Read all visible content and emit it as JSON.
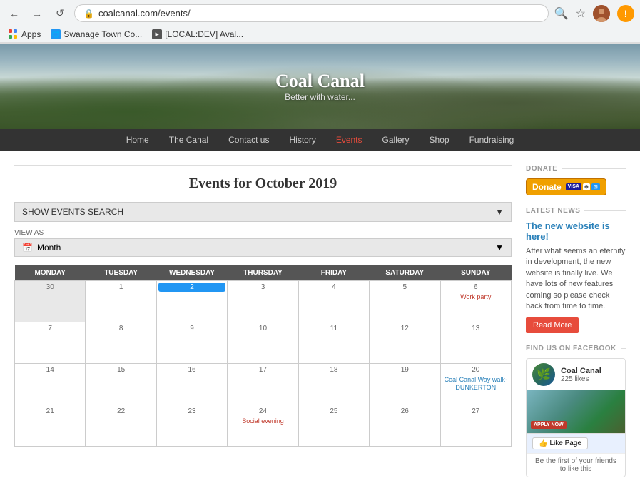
{
  "browser": {
    "back_icon": "←",
    "forward_icon": "→",
    "refresh_icon": "↺",
    "url": "coalcanal.com/events/",
    "search_icon": "🔍",
    "star_icon": "☆",
    "apps_label": "Apps",
    "bookmarks": [
      {
        "id": "swanage",
        "label": "Swanage Town Co...",
        "type": "globe"
      },
      {
        "id": "localdev",
        "label": "[LOCAL:DEV] Aval...",
        "type": "code"
      }
    ]
  },
  "hero": {
    "title": "Coal Canal",
    "subtitle": "Better with water..."
  },
  "nav": {
    "items": [
      {
        "id": "home",
        "label": "Home",
        "active": false
      },
      {
        "id": "canal",
        "label": "The Canal",
        "active": false
      },
      {
        "id": "contact",
        "label": "Contact us",
        "active": false
      },
      {
        "id": "history",
        "label": "History",
        "active": false
      },
      {
        "id": "events",
        "label": "Events",
        "active": true
      },
      {
        "id": "gallery",
        "label": "Gallery",
        "active": false
      },
      {
        "id": "shop",
        "label": "Shop",
        "active": false
      },
      {
        "id": "fundraising",
        "label": "Fundraising",
        "active": false
      }
    ]
  },
  "main": {
    "events_title": "Events for October 2019",
    "show_events_search": "SHOW EVENTS SEARCH",
    "view_as_label": "VIEW AS",
    "view_as_value": "Month",
    "calendar": {
      "headers": [
        "MONDAY",
        "TUESDAY",
        "WEDNESDAY",
        "THURSDAY",
        "FRIDAY",
        "SATURDAY",
        "SUNDAY"
      ],
      "weeks": [
        {
          "days": [
            {
              "num": "30",
              "inactive": true,
              "events": []
            },
            {
              "num": "1",
              "inactive": false,
              "events": []
            },
            {
              "num": "2",
              "inactive": false,
              "today": true,
              "events": []
            },
            {
              "num": "3",
              "inactive": false,
              "events": []
            },
            {
              "num": "4",
              "inactive": false,
              "events": []
            },
            {
              "num": "5",
              "inactive": false,
              "events": []
            },
            {
              "num": "6",
              "inactive": false,
              "events": [
                {
                  "label": "Work party",
                  "color": "red"
                }
              ]
            }
          ]
        },
        {
          "days": [
            {
              "num": "7",
              "inactive": false,
              "events": []
            },
            {
              "num": "8",
              "inactive": false,
              "events": []
            },
            {
              "num": "9",
              "inactive": false,
              "events": []
            },
            {
              "num": "10",
              "inactive": false,
              "events": []
            },
            {
              "num": "11",
              "inactive": false,
              "events": []
            },
            {
              "num": "12",
              "inactive": false,
              "events": []
            },
            {
              "num": "13",
              "inactive": false,
              "events": []
            }
          ]
        },
        {
          "days": [
            {
              "num": "14",
              "inactive": false,
              "events": []
            },
            {
              "num": "15",
              "inactive": false,
              "events": []
            },
            {
              "num": "16",
              "inactive": false,
              "events": []
            },
            {
              "num": "17",
              "inactive": false,
              "events": []
            },
            {
              "num": "18",
              "inactive": false,
              "events": []
            },
            {
              "num": "19",
              "inactive": false,
              "events": []
            },
            {
              "num": "20",
              "inactive": false,
              "events": [
                {
                  "label": "Coal Canal Way walk- DUNKERTON",
                  "color": "blue"
                }
              ]
            }
          ]
        },
        {
          "days": [
            {
              "num": "21",
              "inactive": false,
              "events": []
            },
            {
              "num": "22",
              "inactive": false,
              "events": []
            },
            {
              "num": "23",
              "inactive": false,
              "events": []
            },
            {
              "num": "24",
              "inactive": false,
              "events": [
                {
                  "label": "Social evening",
                  "color": "red"
                }
              ]
            },
            {
              "num": "25",
              "inactive": false,
              "events": []
            },
            {
              "num": "26",
              "inactive": false,
              "events": []
            },
            {
              "num": "27",
              "inactive": false,
              "events": []
            }
          ]
        }
      ]
    }
  },
  "sidebar": {
    "donate_section_title": "DONATE",
    "donate_button_label": "Donate",
    "latest_news_title": "LATEST NEWS",
    "news_headline": "The new website is here!",
    "news_text": "After what seems an eternity in development, the new website is finally live. We have lots of new features coming so please check back from time to time.",
    "read_more_label": "Read More",
    "facebook_section_title": "FIND US ON FACEBOOK",
    "fb_page_name": "Coal Canal",
    "fb_likes": "225 likes",
    "fb_like_button": "👍 Like Page",
    "fb_friends_text": "Be the first of your friends to like this"
  }
}
